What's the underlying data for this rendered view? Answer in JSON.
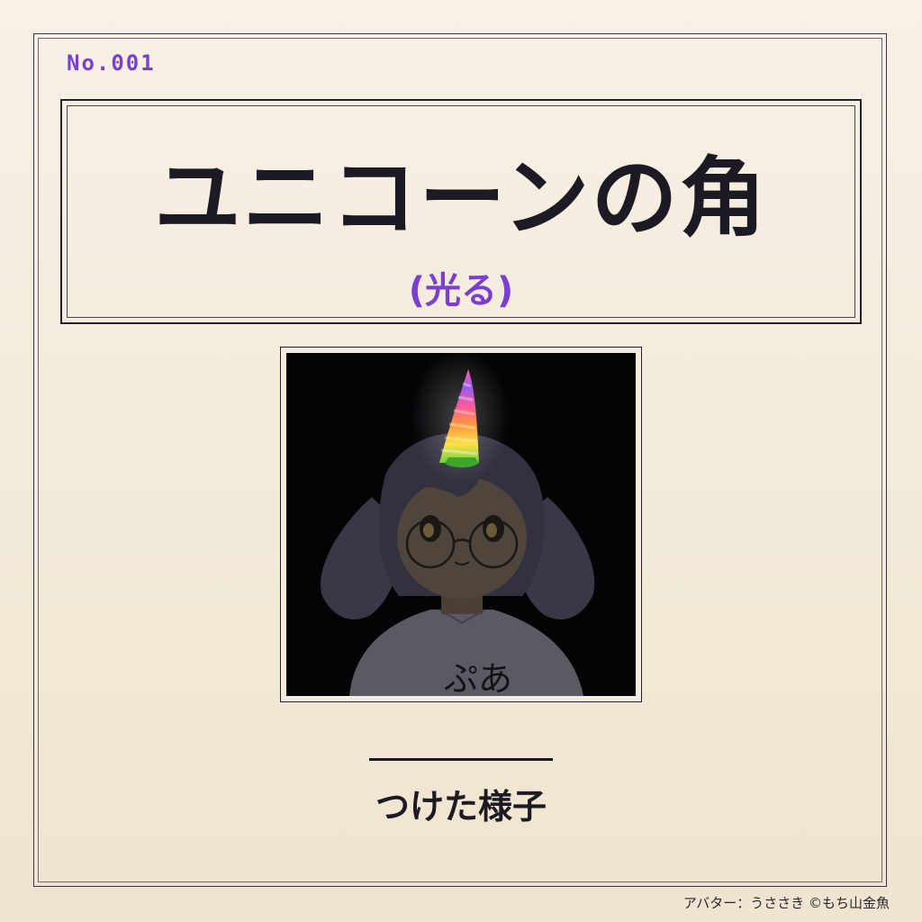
{
  "card": {
    "item_no": "No.001",
    "title": "ユニコーンの角",
    "subtitle": "(光る)",
    "caption": "つけた様子",
    "credit": "アバター：うささき ©もち山金魚"
  },
  "image": {
    "shirt_text": "ぷあ"
  },
  "colors": {
    "accent": "#7a3fd1",
    "ink": "#1e1a24",
    "paper": "#f4ecdd",
    "image_background": "#040306",
    "horn_stripes": [
      "#ff5a9c",
      "#ff9a3c",
      "#ffe043",
      "#6fd24a",
      "#4aa0ff",
      "#9b5cf0"
    ]
  }
}
